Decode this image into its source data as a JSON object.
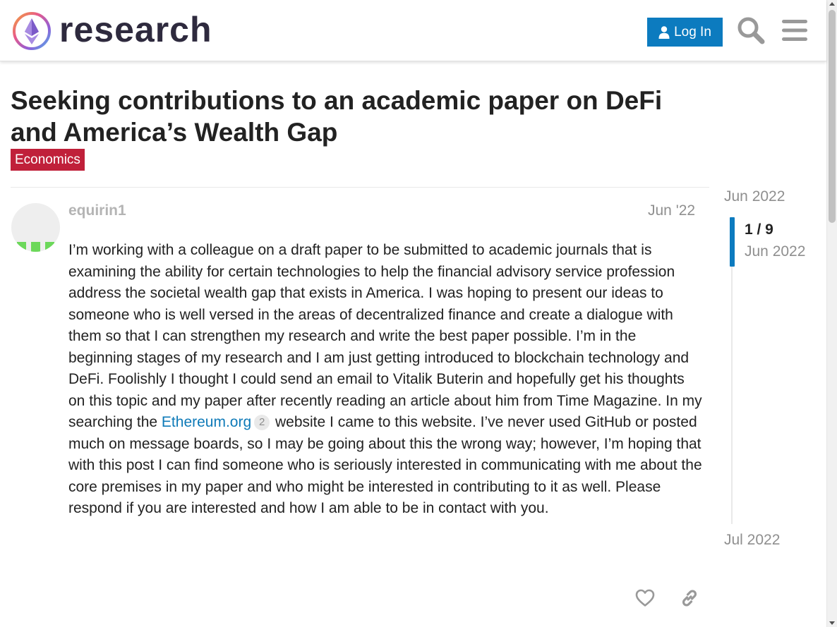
{
  "header": {
    "site_name": "research",
    "login_label": "Log In",
    "accent_color": "#0c7bbf"
  },
  "topic": {
    "title": "Seeking contributions to an academic paper on DeFi and America’s Wealth Gap",
    "category": "Economics",
    "category_color": "#c0203a"
  },
  "post": {
    "username": "equirin1",
    "date": "Jun '22",
    "body_before_link": "I’m working with a colleague on a draft paper to be submitted to academic journals that is examining the ability for certain technologies to help the financial advisory service profession address the societal wealth gap that exists in America. I was hoping to present our ideas to someone who is well versed in the areas of decentralized finance and create a dialogue with them so that I can strengthen my research and write the best paper possible. I’m in the beginning stages of my research and I am just getting introduced to blockchain technology and DeFi. Foolishly I thought I could send an email to Vitalik Buterin and hopefully get his thoughts on this topic and my paper after recently reading an article about him from Time Magazine. In my searching the ",
    "link_text": "Ethereum.org",
    "link_clicks": "2",
    "body_after_link": " website I came to this website. I’ve never used GitHub or posted much on message boards, so I may be going about this the wrong way; however, I’m hoping that with this post I can find someone who is seriously interested in communicating with me about the core premises in my paper and who might be interested in contributing to it as well. Please respond if you are interested and how I am able to be in contact with you."
  },
  "timeline": {
    "start_label": "Jun 2022",
    "counter": "1 / 9",
    "current_date": "Jun 2022",
    "end_label": "Jul 2022"
  }
}
